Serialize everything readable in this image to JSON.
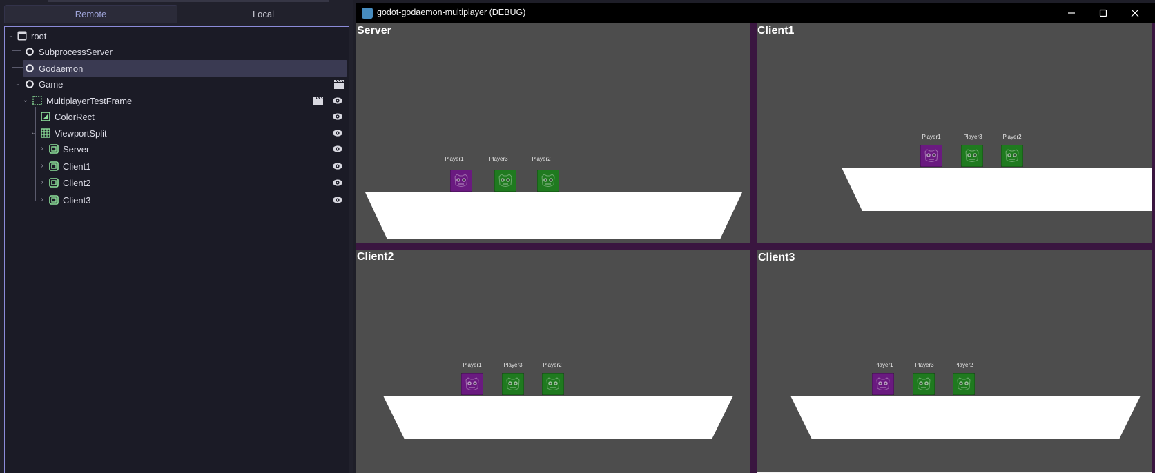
{
  "dock": {
    "tabs": [
      {
        "label": "Remote",
        "active": true
      },
      {
        "label": "Local",
        "active": false
      }
    ],
    "tree": [
      {
        "label": "root",
        "icon": "window-icon",
        "depth": 0,
        "expanded": true
      },
      {
        "label": "SubprocessServer",
        "icon": "node-icon",
        "depth": 1
      },
      {
        "label": "Godaemon",
        "icon": "node-icon",
        "depth": 1,
        "selected": true
      },
      {
        "label": "Game",
        "icon": "node-icon",
        "depth": 1,
        "expanded": true,
        "clapper": true
      },
      {
        "label": "MultiplayerTestFrame",
        "icon": "control-icon",
        "depth": 2,
        "expanded": true,
        "clapper": true,
        "eye": true
      },
      {
        "label": "ColorRect",
        "icon": "colorrect-icon",
        "depth": 3,
        "eye": true
      },
      {
        "label": "ViewportSplit",
        "icon": "gridcontainer-icon",
        "depth": 3,
        "expanded": true,
        "eye": true
      },
      {
        "label": "Server",
        "icon": "subviewport-icon",
        "depth": 4,
        "collapsed": true,
        "eye": true
      },
      {
        "label": "Client1",
        "icon": "subviewport-icon",
        "depth": 4,
        "collapsed": true,
        "eye": true
      },
      {
        "label": "Client2",
        "icon": "subviewport-icon",
        "depth": 4,
        "collapsed": true,
        "eye": true
      },
      {
        "label": "Client3",
        "icon": "subviewport-icon",
        "depth": 4,
        "collapsed": true,
        "eye": true
      }
    ]
  },
  "window": {
    "title": "godot-godaemon-multiplayer (DEBUG)",
    "controls": [
      "minimize-icon",
      "maximize-icon",
      "close-icon"
    ]
  },
  "viewports": [
    {
      "label": "Server",
      "players": [
        "Player1",
        "Player3",
        "Player2"
      ]
    },
    {
      "label": "Client1",
      "players": [
        "Player1",
        "Player3",
        "Player2"
      ]
    },
    {
      "label": "Client2",
      "players": [
        "Player1",
        "Player3",
        "Player2"
      ]
    },
    {
      "label": "Client3",
      "players": [
        "Player1",
        "Player3",
        "Player2"
      ]
    }
  ],
  "colors": {
    "player1": "#6a1a80",
    "player_other": "#1f7a1f",
    "platform": "#ffffff",
    "viewport_bg": "#4d4d4d",
    "accent": "#8b8bd9"
  }
}
